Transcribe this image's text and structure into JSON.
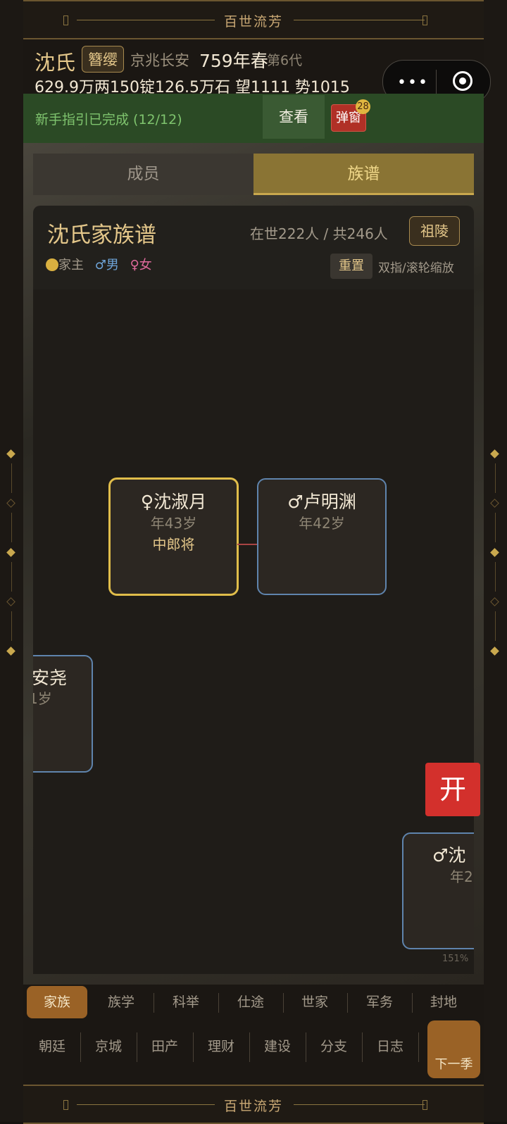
{
  "banner": {
    "title": "百世流芳"
  },
  "header": {
    "clan_name": "沈氏",
    "rank": "簪缨",
    "location": "京兆长安",
    "year": "759年春",
    "generation": "第6代",
    "resources": "629.9万两150锭126.5万石  望1111 势1015"
  },
  "guide": {
    "text": "新手指引已完成 (12/12)",
    "view_label": "查看",
    "popup_label": "弹窗",
    "popup_count": "28"
  },
  "tabs": {
    "members": "成员",
    "tree": "族谱"
  },
  "tree_info": {
    "title": "沈氏家族谱",
    "stats": "在世222人 / 共246人",
    "tomb_label": "祖陵",
    "legend_head": "家主",
    "legend_male": "♂男",
    "legend_female": "♀女",
    "reset_label": "重置",
    "zoom_hint": "双指/滚轮缩放"
  },
  "canvas": {
    "cards": [
      {
        "name": "♀沈淑月",
        "age": "年43岁",
        "office": "中郎将"
      },
      {
        "name": "♂卢明渊",
        "age": "年42岁"
      },
      {
        "name": "安尧",
        "age": "1岁"
      },
      {
        "name": "♂沈",
        "age": "年2"
      }
    ],
    "zoom_level": "151%"
  },
  "open_label": "开",
  "nav": {
    "row1": [
      "家族",
      "族学",
      "科举",
      "仕途",
      "世家",
      "军务",
      "封地"
    ],
    "row2": [
      "朝廷",
      "京城",
      "田产",
      "理财",
      "建设",
      "分支",
      "日志"
    ],
    "next_label": "下一季"
  },
  "colors": {
    "gold": "#e0bd4a",
    "male_blue": "#6ea4d8",
    "female_pink": "#e06a9c",
    "guide_green": "#2b4a25",
    "open_red": "#d3302c",
    "active_tab": "#9a6226"
  }
}
